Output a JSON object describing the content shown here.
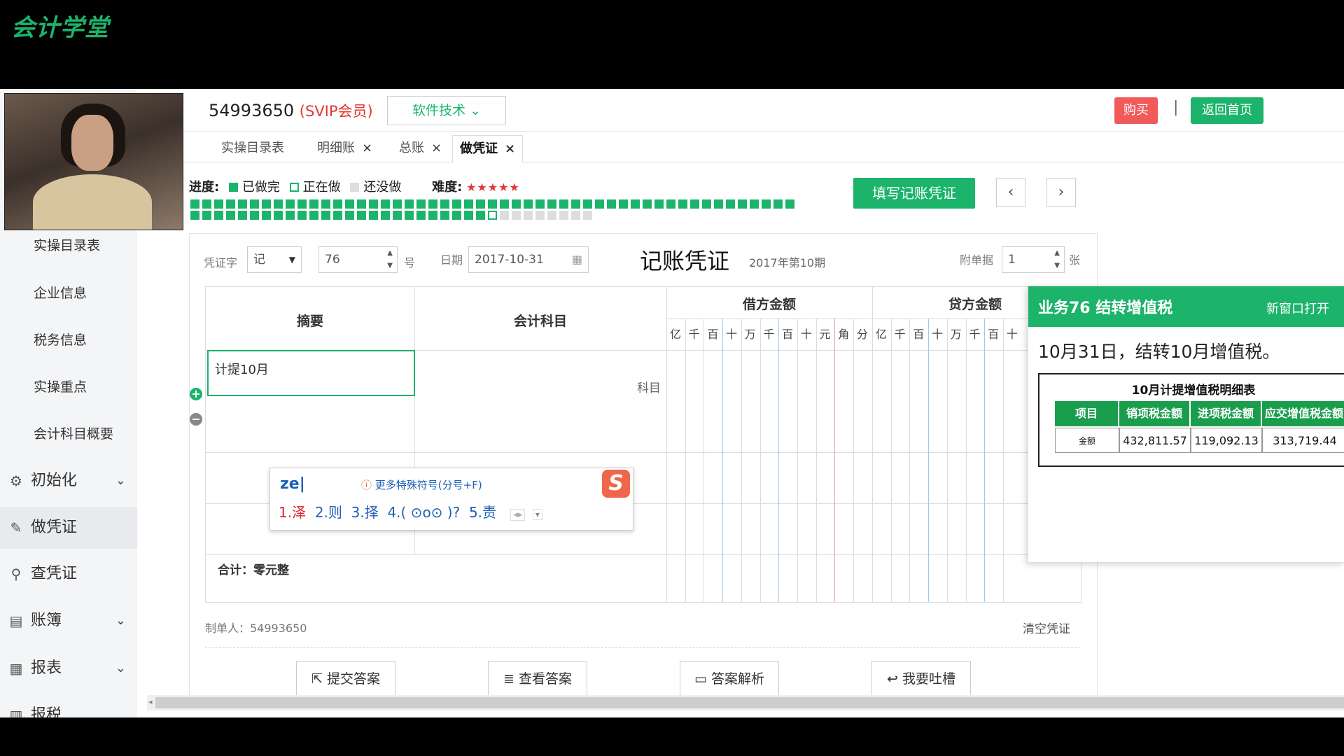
{
  "brand": "会计学堂",
  "sidebar": {
    "items": [
      {
        "label": "实操目录表"
      },
      {
        "label": "企业信息"
      },
      {
        "label": "税务信息"
      },
      {
        "label": "实操重点"
      },
      {
        "label": "会计科目概要"
      }
    ],
    "groups": [
      {
        "label": "初始化",
        "icon": "gear-icon"
      },
      {
        "label": "做凭证",
        "icon": "pencil-icon"
      },
      {
        "label": "查凭证",
        "icon": "search-icon"
      },
      {
        "label": "账簿",
        "icon": "book-icon"
      },
      {
        "label": "报表",
        "icon": "report-icon"
      },
      {
        "label": "报税",
        "icon": "tax-icon"
      }
    ]
  },
  "header": {
    "user_id": "54993650",
    "member": "(SVIP会员)",
    "software_btn": "软件技术",
    "buy": "购买",
    "separator": "|",
    "home": "返回首页"
  },
  "tabs": [
    {
      "label": "实操目录表"
    },
    {
      "label": "明细账"
    },
    {
      "label": "总账"
    },
    {
      "label": "做凭证"
    }
  ],
  "progress": {
    "label": "进度:",
    "done": "已做完",
    "doing": "正在做",
    "todo": "还没做",
    "difficulty": "难度:",
    "stars": "★★★★★",
    "fill_btn": "填写记账凭证",
    "prev": "‹",
    "next": "›"
  },
  "voucher": {
    "word_label": "凭证字",
    "word_value": "记",
    "number": "76",
    "number_unit": "号",
    "date_label": "日期",
    "date": "2017-10-31",
    "title": "记账凭证",
    "period": "2017年第10期",
    "attach_label": "附单据",
    "attach_value": "1",
    "attach_unit": "张",
    "col_summary": "摘要",
    "col_account": "会计科目",
    "col_debit": "借方金额",
    "col_credit": "贷方金额",
    "digits": [
      "亿",
      "千",
      "百",
      "十",
      "万",
      "千",
      "百",
      "十",
      "元",
      "角",
      "分"
    ],
    "credit_digits": [
      "亿",
      "千",
      "百",
      "十",
      "万",
      "千",
      "百",
      "十"
    ],
    "summary_text": "计提10月",
    "account_hint": "科目",
    "total": "合计：零元整",
    "maker": "制单人：54993650",
    "clear": "清空凭证"
  },
  "ime": {
    "input": "ze",
    "hint": "更多特殊符号(分号+F)",
    "candidates": [
      "1.泽",
      "2.则",
      "3.择",
      "4.( ⊙o⊙ )?",
      "5.责"
    ]
  },
  "actions": {
    "submit": "提交答案",
    "view": "查看答案",
    "analysis": "答案解析",
    "feedback": "我要吐槽"
  },
  "business": {
    "title": "业务76 结转增值税",
    "open": "新窗口打开",
    "desc": "10月31日，结转10月增值税。",
    "table_title": "10月计提增值税明细表",
    "headers": [
      "项目",
      "销项税金额",
      "进项税金额",
      "应交增值税金额"
    ],
    "row": [
      "金额",
      "432,811.57",
      "119,092.13",
      "313,719.44"
    ]
  },
  "colors": {
    "accent": "#1cb36b",
    "danger": "#f05a5a"
  }
}
